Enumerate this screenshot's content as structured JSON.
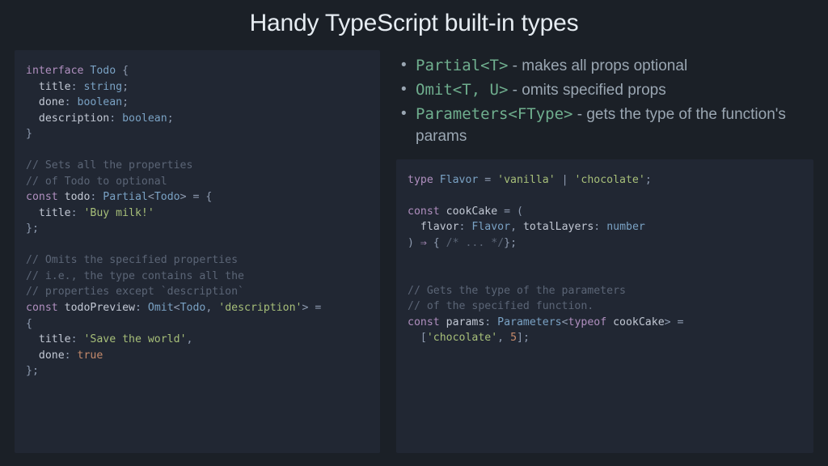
{
  "title": "Handy TypeScript built-in types",
  "bullets": [
    {
      "code": "Partial<T>",
      "desc": " - makes all props optional"
    },
    {
      "code": "Omit<T, U>",
      "desc": " - omits specified props"
    },
    {
      "code": "Parameters<FType>",
      "desc": " - gets the type of the function's params"
    }
  ],
  "left_code": {
    "l01a": "interface",
    "l01b": " Todo",
    "l01c": " {",
    "l02a": "  title",
    "l02b": ":",
    "l02c": " string",
    "l02d": ";",
    "l03a": "  done",
    "l03b": ":",
    "l03c": " boolean",
    "l03d": ";",
    "l04a": "  description",
    "l04b": ":",
    "l04c": " boolean",
    "l04d": ";",
    "l05": "}",
    "l06": "",
    "l07": "// Sets all the properties",
    "l08": "// of Todo to optional",
    "l09a": "const",
    "l09b": " todo",
    "l09c": ":",
    "l09d": " Partial",
    "l09e": "<",
    "l09f": "Todo",
    "l09g": ">",
    "l09h": " = {",
    "l10a": "  title",
    "l10b": ":",
    "l10c": " 'Buy milk!'",
    "l11": "};",
    "l12": "",
    "l13": "// Omits the specified properties",
    "l14": "// i.e., the type contains all the",
    "l15": "// properties except `description`",
    "l16a": "const",
    "l16b": " todoPreview",
    "l16c": ":",
    "l16d": " Omit",
    "l16e": "<",
    "l16f": "Todo",
    "l16g": ",",
    "l16h": " 'description'",
    "l16i": ">",
    "l16j": " = ",
    "l17": "{",
    "l18a": "  title",
    "l18b": ":",
    "l18c": " 'Save the world'",
    "l18d": ",",
    "l19a": "  done",
    "l19b": ":",
    "l19c": " true",
    "l20": "};"
  },
  "right_code": {
    "l01a": "type",
    "l01b": " Flavor",
    "l01c": " =",
    "l01d": " 'vanilla'",
    "l01e": " |",
    "l01f": " 'chocolate'",
    "l01g": ";",
    "l02": "",
    "l03a": "const",
    "l03b": " cookCake",
    "l03c": " = (",
    "l04a": "  flavor",
    "l04b": ":",
    "l04c": " Flavor",
    "l04d": ",",
    "l04e": " totalLayers",
    "l04f": ":",
    "l04g": " number",
    "l05a": ") ",
    "l05b": "⇒",
    "l05c": " {",
    "l05d": " /* ... */",
    "l05e": "};",
    "l06": "",
    "l07": "",
    "l08": "// Gets the type of the parameters",
    "l09": "// of the specified function.",
    "l10a": "const",
    "l10b": " params",
    "l10c": ":",
    "l10d": " Parameters",
    "l10e": "<",
    "l10f": "typeof",
    "l10g": " cookCake",
    "l10h": ">",
    "l10i": " =",
    "l11a": "  [",
    "l11b": "'chocolate'",
    "l11c": ",",
    "l11d": " 5",
    "l11e": "];"
  }
}
